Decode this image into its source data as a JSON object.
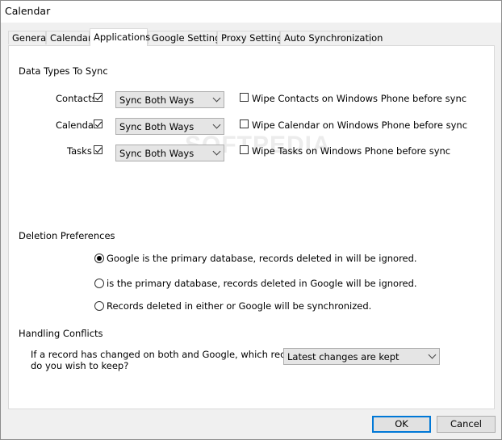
{
  "window": {
    "title": "Calendar"
  },
  "tabs": [
    {
      "label": "General"
    },
    {
      "label": "Calendar"
    },
    {
      "label": "Applications"
    },
    {
      "label": "Google Settings"
    },
    {
      "label": "Proxy Settings"
    },
    {
      "label": "Auto Synchronization"
    }
  ],
  "active_tab": "Applications",
  "watermark": "SOFTPEDIA",
  "data_types": {
    "heading": "Data Types To Sync",
    "rows": [
      {
        "label": "Contacts",
        "checked": true,
        "mode": "Sync Both Ways",
        "wipe_label": "Wipe Contacts on Windows Phone before sync",
        "wipe_checked": false
      },
      {
        "label": "Calendar",
        "checked": true,
        "mode": "Sync Both Ways",
        "wipe_label": "Wipe Calendar on Windows Phone before sync",
        "wipe_checked": false
      },
      {
        "label": "Tasks",
        "checked": true,
        "mode": "Sync Both Ways",
        "wipe_label": "Wipe Tasks on Windows Phone before sync",
        "wipe_checked": false
      }
    ]
  },
  "deletion": {
    "heading": "Deletion Preferences",
    "options": [
      {
        "label": "Google is the primary database, records deleted in  will be ignored.",
        "selected": true
      },
      {
        "label": " is the primary database, records deleted in Google will be ignored.",
        "selected": false
      },
      {
        "label": "Records deleted in either  or Google will be synchronized.",
        "selected": false
      }
    ]
  },
  "conflicts": {
    "heading": "Handling Conflicts",
    "question_line1": "If a record has changed on both  and Google, which record",
    "question_line2": "do you wish to keep?",
    "selected": "Latest changes are kept"
  },
  "buttons": {
    "ok": "OK",
    "cancel": "Cancel"
  }
}
